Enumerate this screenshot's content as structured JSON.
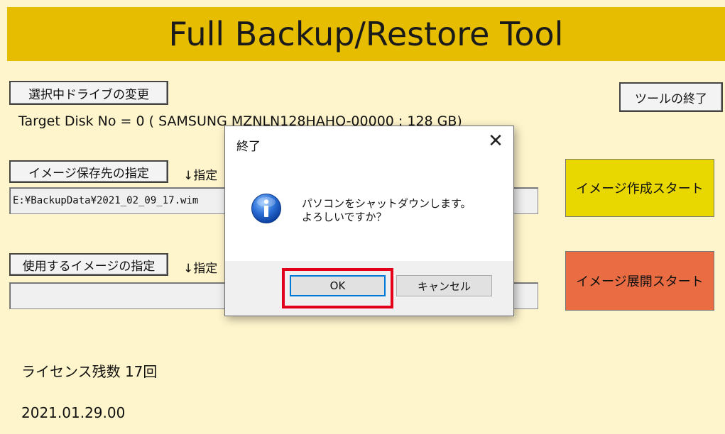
{
  "header": {
    "title": "Full Backup/Restore Tool"
  },
  "drive": {
    "change_button": "選択中ドライブの変更",
    "target_info": "Target Disk No = 0 ( SAMSUNG MZNLN128HAHQ-00000 : 128 GB)"
  },
  "exit_button": "ツールの終了",
  "save_dest": {
    "button": "イメージ保存先の指定",
    "hint": "↓指定",
    "path_value": "E:¥BackupData¥2021_02_09_17.wim"
  },
  "use_image": {
    "button": "使用するイメージの指定",
    "hint": "↓指定",
    "path_value": ""
  },
  "create_start_button": "イメージ作成スタート",
  "restore_start_button": "イメージ展開スタート",
  "license": "ライセンス残数 17回",
  "version": "2021.01.29.00",
  "dialog": {
    "title": "終了",
    "close_glyph": "✕",
    "icon": "information-icon",
    "message_line1": "パソコンをシャットダウンします。",
    "message_line2": "よろしいですか？",
    "ok_label": "OK",
    "cancel_label": "キャンセル"
  },
  "colors": {
    "background": "#fff5cc",
    "title_bar": "#e6bd00",
    "create_button": "#e8d800",
    "restore_button": "#e96c43",
    "highlight": "#e3001b"
  }
}
